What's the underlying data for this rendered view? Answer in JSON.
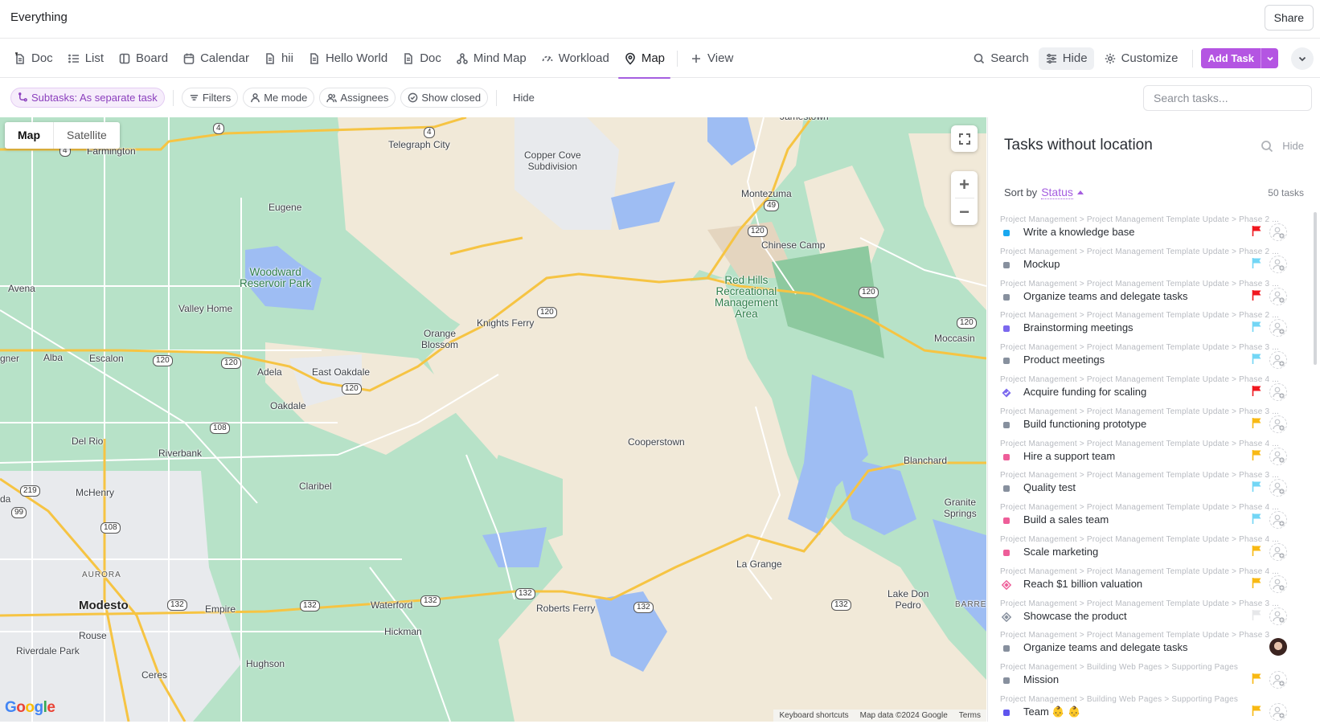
{
  "header": {
    "title": "Everything",
    "share_label": "Share"
  },
  "views": {
    "tabs": [
      {
        "label": "Doc",
        "icon": "doc-pinned-icon"
      },
      {
        "label": "List",
        "icon": "list-icon"
      },
      {
        "label": "Board",
        "icon": "board-icon"
      },
      {
        "label": "Calendar",
        "icon": "calendar-icon"
      },
      {
        "label": "hii",
        "icon": "doc-icon"
      },
      {
        "label": "Hello World",
        "icon": "doc-icon"
      },
      {
        "label": "Doc",
        "icon": "doc-icon"
      },
      {
        "label": "Mind Map",
        "icon": "mind-map-icon"
      },
      {
        "label": "Workload",
        "icon": "workload-icon"
      },
      {
        "label": "Map",
        "icon": "map-pin-icon",
        "active": true
      }
    ],
    "add_view_label": "View",
    "search_label": "Search",
    "hide_label": "Hide",
    "customize_label": "Customize",
    "add_task_label": "Add Task"
  },
  "filters": {
    "subtasks_label": "Subtasks: As separate task",
    "filters_label": "Filters",
    "me_mode_label": "Me mode",
    "assignees_label": "Assignees",
    "show_closed_label": "Show closed",
    "hide_label": "Hide",
    "search_placeholder": "Search tasks..."
  },
  "map": {
    "type_map": "Map",
    "type_satellite": "Satellite",
    "logo": "Google",
    "attribution": {
      "shortcuts": "Keyboard shortcuts",
      "data": "Map data ©2024 Google",
      "terms": "Terms"
    },
    "places": [
      "Farmington",
      "Telegraph City",
      "Copper Cove\nSubdivision",
      "Jamestown",
      "Eugene",
      "Montezuma",
      "Chinese Camp",
      "Woodward\nReservoir Park",
      "Red Hills\nRecreational\nManagement\nArea",
      "Avena",
      "Valley Home",
      "Knights Ferry",
      "Orange\nBlossom",
      "Moccasin",
      "gner",
      "Alba",
      "Escalon",
      "Adela",
      "East Oakdale",
      "Oakdale",
      "Cooperstown",
      "Del Rio",
      "Riverbank",
      "Blanchard",
      "McHenry",
      "Claribel",
      "Granite\nSprings",
      "da",
      "AURORA",
      "La Grange",
      "Modesto",
      "Empire",
      "Waterford",
      "Roberts Ferry",
      "Lake Don\nPedro",
      "BARRETT",
      "Rouse",
      "Hickman",
      "Riverdale Park",
      "Hughson",
      "Ceres"
    ],
    "route_shields": [
      "4",
      "4",
      "4",
      "49",
      "120",
      "120",
      "120",
      "120",
      "120",
      "120",
      "120",
      "108",
      "108",
      "219",
      "99",
      "132",
      "132",
      "132",
      "132",
      "132",
      "132"
    ]
  },
  "panel": {
    "title": "Tasks without location",
    "hide_label": "Hide",
    "sort_by_label": "Sort by",
    "sort_field": "Status",
    "task_count": "50 tasks",
    "tasks": [
      {
        "path": "Project Management > Project Management Template Update > Phase 2 ...",
        "name": "Write a knowledge base",
        "status_color": "#1aa8f0",
        "status_shape": "square",
        "priority": "urgent",
        "flag_color": "#f0171f",
        "assignee": "none"
      },
      {
        "path": "Project Management > Project Management Template Update > Phase 2 ...",
        "name": "Mockup",
        "status_color": "#87909e",
        "status_shape": "square",
        "priority": "low",
        "flag_color": "#72d6f5",
        "assignee": "none"
      },
      {
        "path": "Project Management > Project Management Template Update > Phase 3 ...",
        "name": "Organize teams and delegate tasks",
        "status_color": "#87909e",
        "status_shape": "square",
        "priority": "urgent",
        "flag_color": "#f0171f",
        "assignee": "none"
      },
      {
        "path": "Project Management > Project Management Template Update > Phase 2 ...",
        "name": "Brainstorming meetings",
        "status_color": "#7b68ee",
        "status_shape": "square",
        "priority": "low",
        "flag_color": "#72d6f5",
        "assignee": "none"
      },
      {
        "path": "Project Management > Project Management Template Update > Phase 3 ...",
        "name": "Product meetings",
        "status_color": "#87909e",
        "status_shape": "square",
        "priority": "low",
        "flag_color": "#72d6f5",
        "assignee": "none"
      },
      {
        "path": "Project Management > Project Management Template Update > Phase 4 ...",
        "name": "Acquire funding for scaling",
        "status_color": "#7b68ee",
        "status_shape": "milestone-check",
        "priority": "urgent",
        "flag_color": "#f0171f",
        "assignee": "none"
      },
      {
        "path": "Project Management > Project Management Template Update > Phase 3 ...",
        "name": "Build functioning prototype",
        "status_color": "#87909e",
        "status_shape": "square",
        "priority": "high",
        "flag_color": "#f8b913",
        "assignee": "none"
      },
      {
        "path": "Project Management > Project Management Template Update > Phase 4 ...",
        "name": "Hire a support team",
        "status_color": "#ee5e99",
        "status_shape": "square",
        "priority": "high",
        "flag_color": "#f8b913",
        "assignee": "none"
      },
      {
        "path": "Project Management > Project Management Template Update > Phase 3 ...",
        "name": "Quality test",
        "status_color": "#87909e",
        "status_shape": "square",
        "priority": "low",
        "flag_color": "#72d6f5",
        "assignee": "none"
      },
      {
        "path": "Project Management > Project Management Template Update > Phase 4 ...",
        "name": "Build a sales team",
        "status_color": "#ee5e99",
        "status_shape": "square",
        "priority": "low",
        "flag_color": "#72d6f5",
        "assignee": "none"
      },
      {
        "path": "Project Management > Project Management Template Update > Phase 4 ...",
        "name": "Scale marketing",
        "status_color": "#ee5e99",
        "status_shape": "square",
        "priority": "high",
        "flag_color": "#f8b913",
        "assignee": "none"
      },
      {
        "path": "Project Management > Project Management Template Update > Phase 4 ...",
        "name": "Reach $1 billion valuation",
        "status_color": "#ee5e99",
        "status_shape": "milestone",
        "priority": "high",
        "flag_color": "#f8b913",
        "assignee": "none"
      },
      {
        "path": "Project Management > Project Management Template Update > Phase 3 ...",
        "name": "Showcase the product",
        "status_color": "#87909e",
        "status_shape": "milestone",
        "priority": "none",
        "flag_color": "#e6e7e9",
        "assignee": "none"
      },
      {
        "path": "Project Management > Project Management Template Update > Phase 3",
        "name": "Organize teams and delegate tasks",
        "status_color": "#87909e",
        "status_shape": "square",
        "priority": "",
        "flag_color": "",
        "assignee": "avatar"
      },
      {
        "path": "Project Management > Building Web Pages > Supporting Pages",
        "name": "Mission",
        "status_color": "#87909e",
        "status_shape": "square",
        "priority": "high",
        "flag_color": "#f8b913",
        "assignee": "none"
      },
      {
        "path": "Project Management > Building Web Pages > Supporting Pages",
        "name": "Team 👶 👶",
        "status_color": "#5f55ee",
        "status_shape": "square",
        "priority": "high",
        "flag_color": "#f8b913",
        "assignee": "none"
      }
    ]
  },
  "colors": {
    "accent": "#a55ee0",
    "add_task": "#b455e2"
  }
}
